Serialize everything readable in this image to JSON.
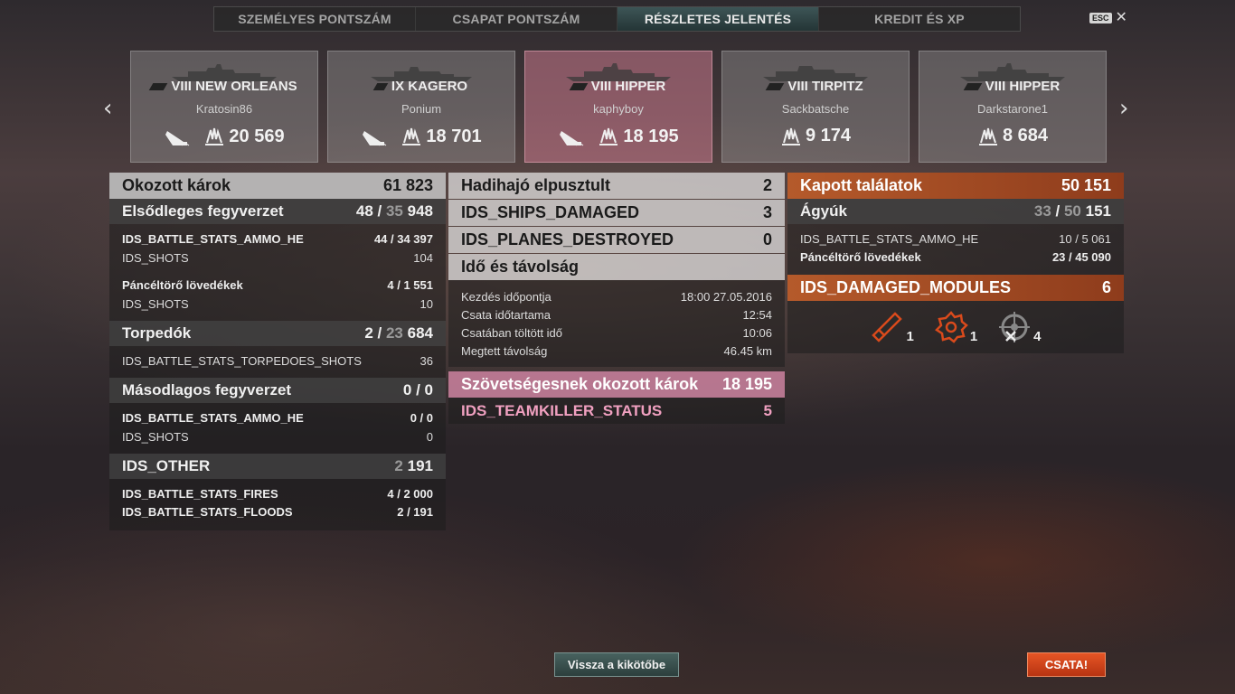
{
  "tabs": [
    {
      "label": "SZEMÉLYES PONTSZÁM",
      "active": false
    },
    {
      "label": "CSAPAT PONTSZÁM",
      "active": false
    },
    {
      "label": "RÉSZLETES JELENTÉS",
      "active": true
    },
    {
      "label": "KREDIT ÉS XP",
      "active": false
    }
  ],
  "esc_label": "ESC",
  "close_glyph": "✕",
  "nav": {
    "prev": "‹",
    "next": "›"
  },
  "ships": [
    {
      "tier_name": "VIII NEW ORLEANS",
      "player": "Kratosin86",
      "damage": "20 569",
      "sunk_icon": true,
      "own": false
    },
    {
      "tier_name": "IX KAGERO",
      "player": "Ponium",
      "damage": "18 701",
      "sunk_icon": true,
      "own": false
    },
    {
      "tier_name": "VIII HIPPER",
      "player": "kaphyboy",
      "damage": "18 195",
      "sunk_icon": true,
      "own": true
    },
    {
      "tier_name": "VIII TIRPITZ",
      "player": "Sackbatsche",
      "damage": "9 174",
      "sunk_icon": false,
      "own": false
    },
    {
      "tier_name": "VIII HIPPER",
      "player": "Darkstarone1",
      "damage": "8 684",
      "sunk_icon": false,
      "own": false
    }
  ],
  "damage_dealt": {
    "title": "Okozott károk",
    "total": "61 823",
    "primary": {
      "title": "Elsődleges fegyverzet",
      "hits": "48",
      "shots": "35",
      "damage": "948",
      "rows": [
        {
          "label": "IDS_BATTLE_STATS_AMMO_HE",
          "value": "44 / 34 397",
          "bold": true
        },
        {
          "label": "IDS_SHOTS",
          "value": "104",
          "bold": false
        },
        {
          "label": "Páncéltörő lövedékek",
          "value": "4 / 1 551",
          "bold": true
        },
        {
          "label": "IDS_SHOTS",
          "value": "10",
          "bold": false
        }
      ]
    },
    "torpedoes": {
      "title": "Torpedók",
      "hits": "2",
      "shots": "23",
      "damage": "684",
      "rows": [
        {
          "label": "IDS_BATTLE_STATS_TORPEDOES_SHOTS",
          "value": "36",
          "bold": false
        }
      ]
    },
    "secondary": {
      "title": "Másodlagos fegyverzet",
      "value": "0 / 0",
      "rows": [
        {
          "label": "IDS_BATTLE_STATS_AMMO_HE",
          "value": "0 / 0",
          "bold": true
        },
        {
          "label": "IDS_SHOTS",
          "value": "0",
          "bold": false
        }
      ]
    },
    "other": {
      "title": "IDS_OTHER",
      "total_prefix": "2",
      "total_suffix": "191",
      "rows": [
        {
          "label": "IDS_BATTLE_STATS_FIRES",
          "value": "4 / 2 000",
          "bold": true
        },
        {
          "label": "IDS_BATTLE_STATS_FLOODS",
          "value": "2 / 191",
          "bold": true
        }
      ]
    }
  },
  "center": {
    "destroyed": {
      "label": "Hadihajó elpusztult",
      "value": "2"
    },
    "ships_damaged": {
      "label": "IDS_SHIPS_DAMAGED",
      "value": "3"
    },
    "planes_destroyed": {
      "label": "IDS_PLANES_DESTROYED",
      "value": "0"
    },
    "time": {
      "title": "Idő és távolság",
      "rows": [
        {
          "label": "Kezdés időpontja",
          "value": "18:00  27.05.2016"
        },
        {
          "label": "Csata időtartama",
          "value": "12:54"
        },
        {
          "label": "Csatában töltött idő",
          "value": "10:06"
        },
        {
          "label": "Megtett távolság",
          "value": "46.45 km"
        }
      ]
    },
    "ally_damage": {
      "label": "Szövetségesnek okozott károk",
      "value": "18 195"
    },
    "teamkiller": {
      "label": "IDS_TEAMKILLER_STATUS",
      "value": "5"
    }
  },
  "received": {
    "title": "Kapott találatok",
    "total": "50 151",
    "guns": {
      "title": "Ágyúk",
      "hits": "33",
      "shots": "50",
      "damage": "151"
    },
    "rows": [
      {
        "label": "IDS_BATTLE_STATS_AMMO_HE",
        "value": "10 / 5 061",
        "bold": false
      },
      {
        "label": "Páncéltörő lövedékek",
        "value": "23 / 45 090",
        "bold": true
      }
    ],
    "modules": {
      "title": "IDS_DAMAGED_MODULES",
      "total": "6",
      "items": [
        {
          "icon": "gun-module-icon",
          "count": "1",
          "color": "#d94a1c"
        },
        {
          "icon": "engine-module-icon",
          "count": "1",
          "color": "#d94a1c"
        },
        {
          "icon": "steering-module-icon",
          "count": "4",
          "color": "#888888"
        }
      ]
    }
  },
  "buttons": {
    "port": "Vissza a kikötőbe",
    "battle": "CSATA!"
  },
  "colors": {
    "accent_orange": "#b55a2b",
    "own_ship": "#c8788c",
    "teamkiller": "#f0a0c0",
    "battle_button": "#d9441a"
  }
}
